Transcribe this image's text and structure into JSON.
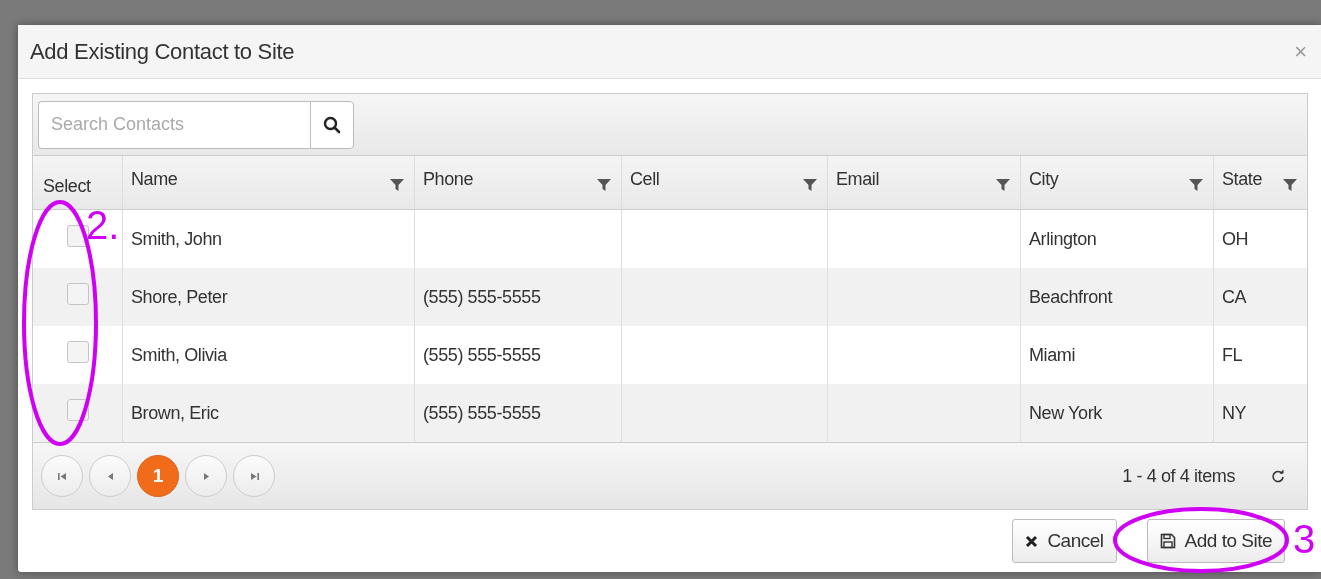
{
  "dialog": {
    "title": "Add Existing Contact to Site",
    "close": "×"
  },
  "search": {
    "placeholder": "Search Contacts"
  },
  "table": {
    "columns": [
      {
        "label": "Select",
        "filter": false
      },
      {
        "label": "Name",
        "filter": true
      },
      {
        "label": "Phone",
        "filter": true
      },
      {
        "label": "Cell",
        "filter": true
      },
      {
        "label": "Email",
        "filter": true
      },
      {
        "label": "City",
        "filter": true
      },
      {
        "label": "State",
        "filter": true
      }
    ],
    "rows": [
      {
        "checked": false,
        "cells": [
          "",
          "Smith, John",
          "",
          "",
          "",
          "Arlington",
          "OH"
        ]
      },
      {
        "checked": false,
        "cells": [
          "",
          "Shore, Peter",
          "(555) 555-5555",
          "",
          "",
          "Beachfront",
          "CA"
        ]
      },
      {
        "checked": false,
        "cells": [
          "",
          "Smith, Olivia",
          "(555) 555-5555",
          "",
          "",
          "Miami",
          "FL"
        ]
      },
      {
        "checked": false,
        "cells": [
          "",
          "Brown, Eric",
          "(555) 555-5555",
          "",
          "",
          "New York",
          "NY"
        ]
      }
    ]
  },
  "pager": {
    "pages": [
      {
        "label": "1",
        "selected": true
      }
    ],
    "summary": "1 - 4 of 4 items"
  },
  "buttons": [
    {
      "kind": "cancel",
      "label": "Cancel"
    },
    {
      "kind": "save",
      "label": "Add to Site"
    }
  ],
  "annotations": [
    "2.",
    "3"
  ]
}
